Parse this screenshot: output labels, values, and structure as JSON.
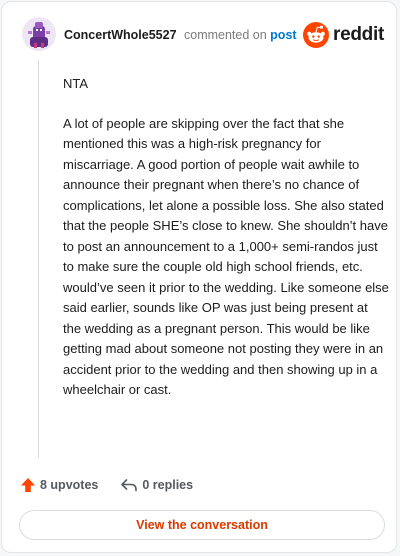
{
  "comment": {
    "author": "ConcertWhole5527",
    "meta_prefix": "commented on",
    "meta_link": "post",
    "paragraphs": [
      "NTA",
      "A lot of people are skipping over the fact that she mentioned this was a high-risk pregnancy for miscarriage. A good portion of people wait awhile to announce their pregnant when there’s no chance of complications, let alone a possible loss. She also stated that the people SHE’s close to knew. She shouldn’t have to post an announcement to a 1,000+ semi-randos just to make sure the couple old high school friends, etc. would’ve seen it prior to the wedding. Like someone else said earlier, sounds like OP was just being present at the wedding as a pregnant person. This would be like getting mad about someone not posting they were in an accident prior to the wedding and then showing up in a wheelchair or cast."
    ]
  },
  "brand": {
    "name": "reddit",
    "icon": "reddit-logo-icon",
    "color": "#ff4500"
  },
  "actions": {
    "upvotes_label": "8 upvotes",
    "upvote_icon": "upvote-arrow-icon",
    "replies_label": "0 replies",
    "reply_icon": "reply-arrow-icon"
  },
  "footer": {
    "view_button_label": "View the conversation"
  },
  "colors": {
    "accent": "#d93a00",
    "link": "#0079d3",
    "upvote": "#ff4500"
  }
}
